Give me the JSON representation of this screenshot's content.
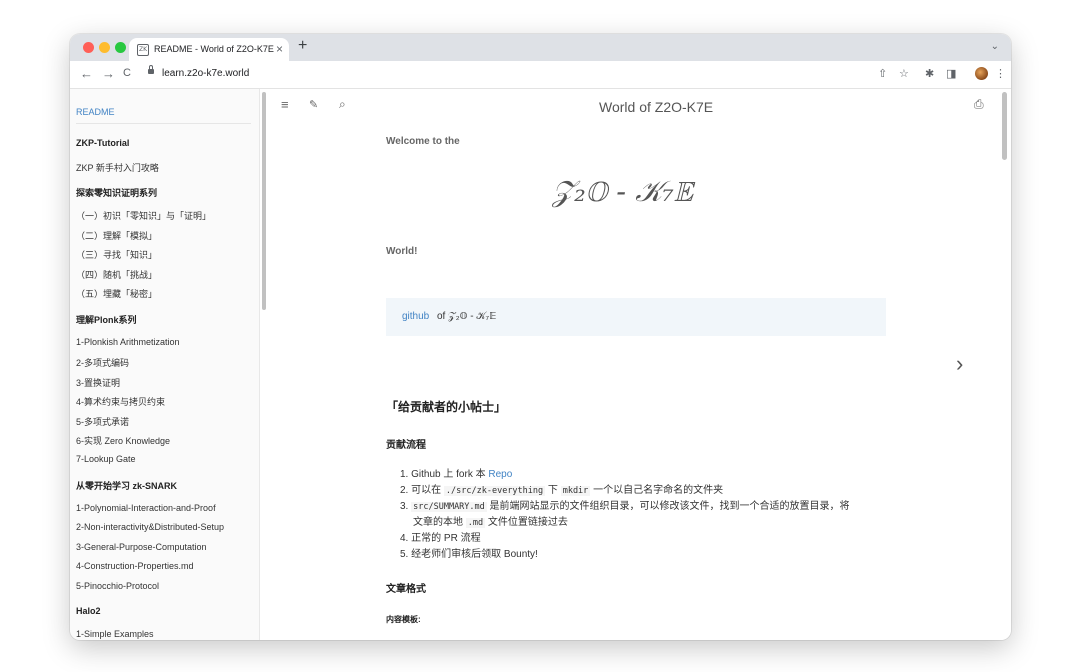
{
  "browser": {
    "tab_title": "README - World of Z2O-K7E",
    "tab_close": "×",
    "new_tab": "+",
    "tab_menu": "⌄",
    "url": "learn.z2o-k7e.world",
    "favicon": "ZK",
    "nav": {
      "back": "←",
      "forward": "→",
      "reload": "C"
    },
    "toolbar_icons": {
      "share": "⇧",
      "bookmark": "☆",
      "extensions": "✱",
      "sidepanel": "◨",
      "menu": "⋮"
    },
    "traffic_lights": {
      "close": "#ff5f57",
      "minimize": "#febc2e",
      "maximize": "#28c840"
    }
  },
  "sidebar": {
    "items": [
      {
        "label": "README",
        "type": "active"
      },
      {
        "label": "ZKP-Tutorial",
        "type": "header"
      },
      {
        "label": "ZKP 新手村入门攻略",
        "type": "item"
      },
      {
        "label": "探索零知识证明系列",
        "type": "header"
      },
      {
        "label": "（一）初识「零知识」与「证明」",
        "type": "item"
      },
      {
        "label": "（二）理解「模拟」",
        "type": "item"
      },
      {
        "label": "（三）寻找「知识」",
        "type": "item"
      },
      {
        "label": "（四）随机「挑战」",
        "type": "item"
      },
      {
        "label": "（五）埋藏「秘密」",
        "type": "item"
      },
      {
        "label": "理解Plonk系列",
        "type": "header"
      },
      {
        "label": "1-Plonkish Arithmetization",
        "type": "item"
      },
      {
        "label": "2-多项式编码",
        "type": "item"
      },
      {
        "label": "3-置换证明",
        "type": "item"
      },
      {
        "label": "4-算术约束与拷贝约束",
        "type": "item"
      },
      {
        "label": "5-多项式承诺",
        "type": "item"
      },
      {
        "label": "6-实现 Zero Knowledge",
        "type": "item"
      },
      {
        "label": "7-Lookup Gate",
        "type": "item"
      },
      {
        "label": "从零开始学习 zk-SNARK",
        "type": "header"
      },
      {
        "label": "1-Polynomial-Interaction-and-Proof",
        "type": "item"
      },
      {
        "label": "2-Non-interactivity&Distributed-Setup",
        "type": "item"
      },
      {
        "label": "3-General-Purpose-Computation",
        "type": "item"
      },
      {
        "label": "4-Construction-Properties.md",
        "type": "item"
      },
      {
        "label": "5-Pinocchio-Protocol",
        "type": "item"
      },
      {
        "label": "Halo2",
        "type": "header"
      },
      {
        "label": "1-Simple Examples",
        "type": "item"
      }
    ]
  },
  "content": {
    "menu_icons": {
      "menu": "≡",
      "theme": "✎",
      "search": "⌕",
      "print": "⎙"
    },
    "page_title": "World of Z2O-K7E",
    "welcome": "Welcome to the",
    "logo": "𝒵₂𝕆 - 𝒦₇𝔼",
    "world": "World!",
    "github_link": "github",
    "github_rest": "of 𝒵₂𝕆 - 𝒦₇𝔼",
    "next_arrow": "›",
    "tips_title": "「给贡献者的小帖士」",
    "process_title": "贡献流程",
    "steps": {
      "s1_num": "1.",
      "s1_text": "Github 上 fork 本 ",
      "s1_link": "Repo",
      "s2_num": "2.",
      "s2_text1": "可以在 ",
      "s2_code1": "./src/zk-everything",
      "s2_text2": " 下 ",
      "s2_code2": "mkdir",
      "s2_text3": " 一个以自己名字命名的文件夹",
      "s3_num": "3.",
      "s3_code1": "src/SUMMARY.md",
      "s3_text1": " 是前端网站显示的文件组织目录，可以修改该文件，找到一个合适的放置目录，将",
      "s3_text2": "文章的本地 ",
      "s3_code2": ".md",
      "s3_text3": " 文件位置链接过去",
      "s4_num": "4.",
      "s4_text": "正常的 PR 流程",
      "s5_num": "5.",
      "s5_text": "经老师们审核后领取 Bounty!"
    },
    "format_title": "文章格式",
    "template_title": "内容模板:"
  }
}
